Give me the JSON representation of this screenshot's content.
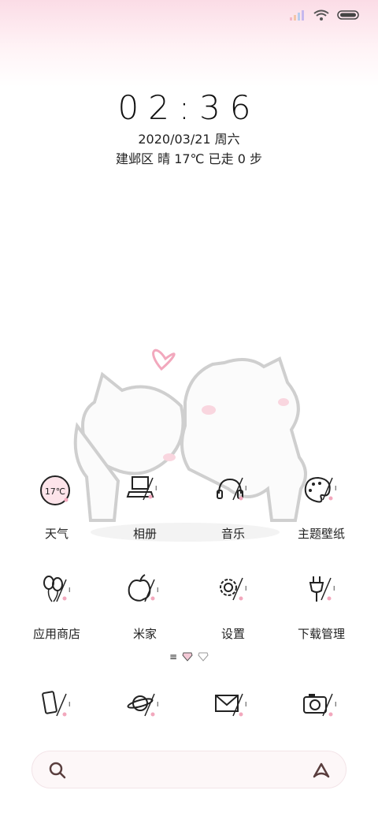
{
  "clock": {
    "time": "02:36"
  },
  "date_line": "2020/03/21 周六",
  "info_line": "建邺区 晴 17℃  已走 0 步",
  "apps_row1": [
    {
      "label": "天气",
      "icon": "weather-icon",
      "badge": "17℃"
    },
    {
      "label": "相册",
      "icon": "laptop-icon"
    },
    {
      "label": "音乐",
      "icon": "headphones-icon"
    },
    {
      "label": "主题壁纸",
      "icon": "palette-icon"
    }
  ],
  "apps_row2": [
    {
      "label": "应用商店",
      "icon": "balloons-icon"
    },
    {
      "label": "米家",
      "icon": "apple-icon"
    },
    {
      "label": "设置",
      "icon": "gear-icon"
    },
    {
      "label": "下载管理",
      "icon": "plug-icon"
    }
  ],
  "dock": [
    {
      "icon": "phone-icon"
    },
    {
      "icon": "planet-icon"
    },
    {
      "icon": "envelope-icon"
    },
    {
      "icon": "camera-icon"
    }
  ],
  "page_indicator": {
    "menu": "≡"
  },
  "colors": {
    "accent_pink": "#f2a8bd",
    "icon_stroke": "#222222"
  }
}
